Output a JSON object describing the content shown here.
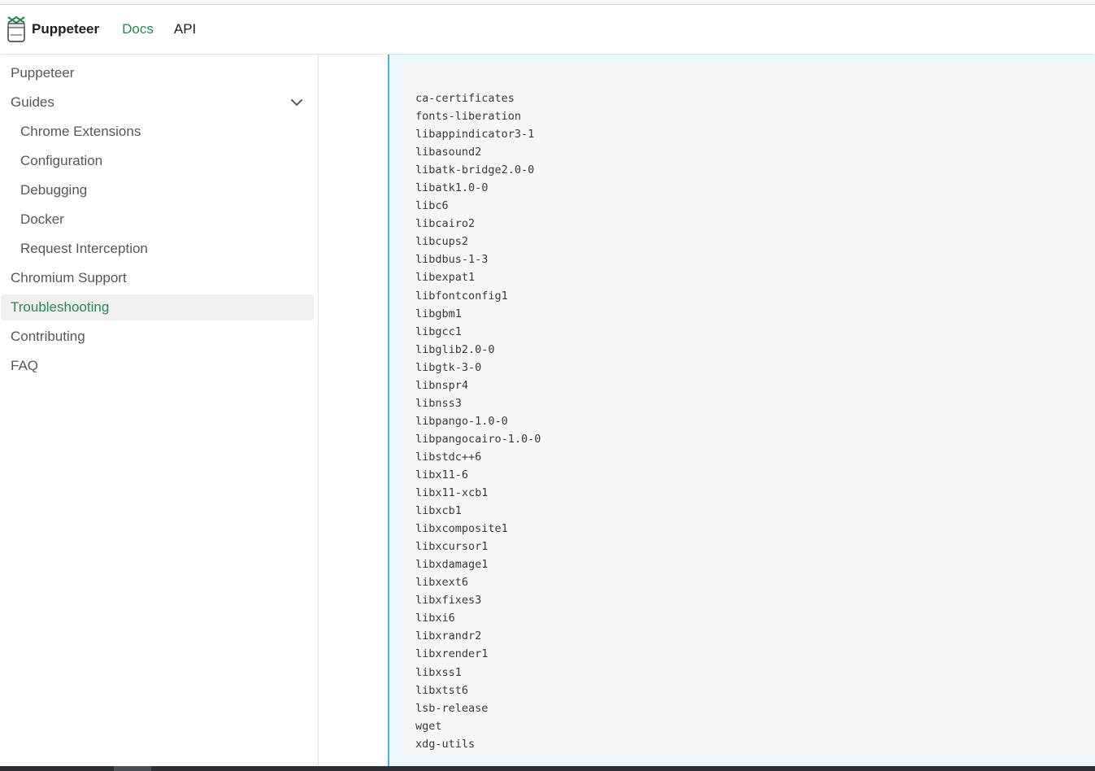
{
  "navbar": {
    "brand_title": "Puppeteer",
    "links": [
      {
        "label": "Docs",
        "active": true
      },
      {
        "label": "API",
        "active": false
      }
    ]
  },
  "sidebar": {
    "items": [
      {
        "label": "Puppeteer",
        "level": 0
      },
      {
        "label": "Guides",
        "level": 0,
        "expanded": true
      },
      {
        "label": "Chrome Extensions",
        "level": 1
      },
      {
        "label": "Configuration",
        "level": 1
      },
      {
        "label": "Debugging",
        "level": 1
      },
      {
        "label": "Docker",
        "level": 1
      },
      {
        "label": "Request Interception",
        "level": 1
      },
      {
        "label": "Chromium Support",
        "level": 0
      },
      {
        "label": "Troubleshooting",
        "level": 0,
        "active": true
      },
      {
        "label": "Contributing",
        "level": 0
      },
      {
        "label": "FAQ",
        "level": 0
      }
    ]
  },
  "code": {
    "lines": [
      "ca-certificates",
      "fonts-liberation",
      "libappindicator3-1",
      "libasound2",
      "libatk-bridge2.0-0",
      "libatk1.0-0",
      "libc6",
      "libcairo2",
      "libcups2",
      "libdbus-1-3",
      "libexpat1",
      "libfontconfig1",
      "libgbm1",
      "libgcc1",
      "libglib2.0-0",
      "libgtk-3-0",
      "libnspr4",
      "libnss3",
      "libpango-1.0-0",
      "libpangocairo-1.0-0",
      "libstdc++6",
      "libx11-6",
      "libx11-xcb1",
      "libxcb1",
      "libxcomposite1",
      "libxcursor1",
      "libxdamage1",
      "libxext6",
      "libxfixes3",
      "libxi6",
      "libxrandr2",
      "libxrender1",
      "libxss1",
      "libxtst6",
      "lsb-release",
      "wget",
      "xdg-utils"
    ]
  },
  "colors": {
    "accent": "#2e8555",
    "info_border": "#4cb3d4",
    "info_background": "#eef9fd",
    "code_background": "#f6f7f8"
  }
}
